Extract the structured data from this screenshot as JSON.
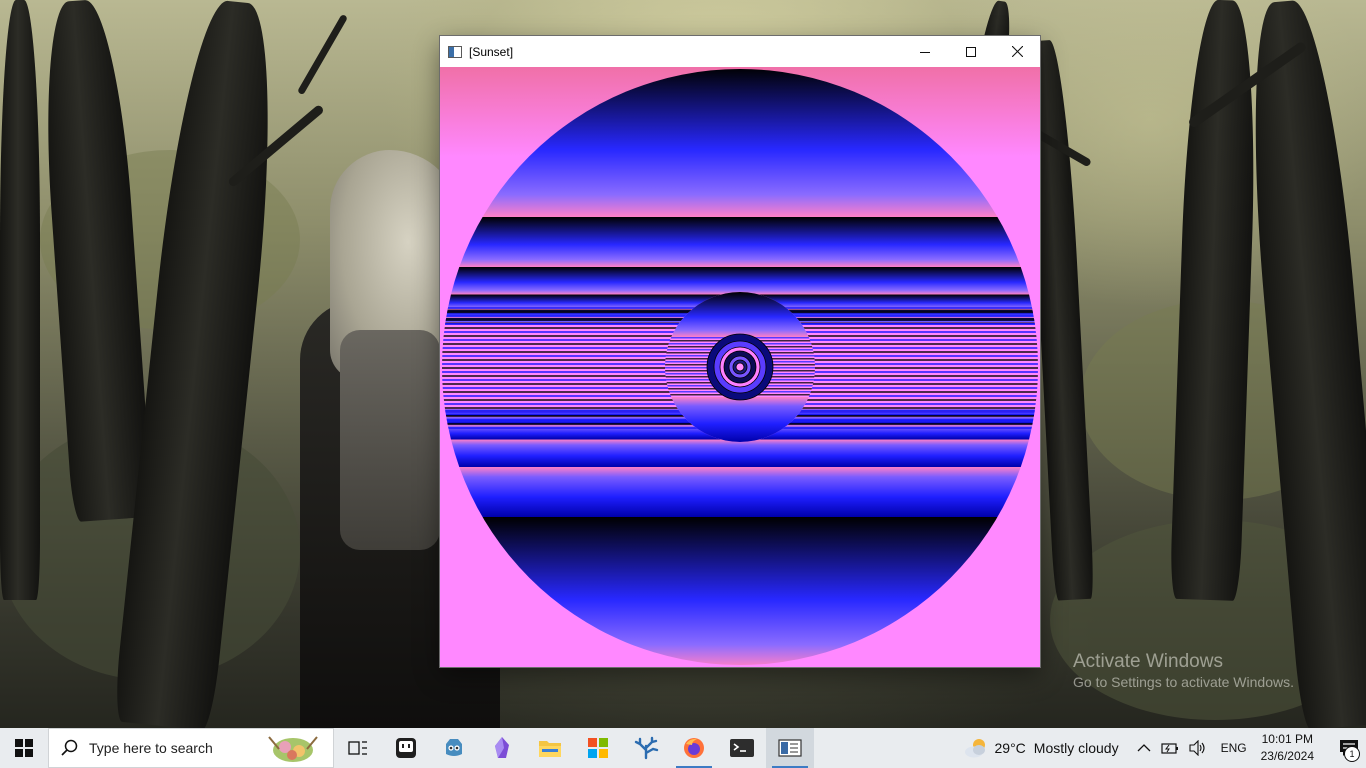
{
  "desktop": {
    "watermark": {
      "title": "Activate Windows",
      "subtitle": "Go to Settings to activate Windows."
    }
  },
  "window": {
    "title": "[Sunset]",
    "controls": [
      "minimize-icon",
      "maximize-icon",
      "close-icon"
    ],
    "render": {
      "sky_top": "#f070a8",
      "sky_mid": "#ff88ff",
      "disc_dark": "#000000",
      "disc_bright": "#1f1fff",
      "band_pink": "#ff80c8"
    }
  },
  "taskbar": {
    "search_placeholder": "Type here to search",
    "pinned": [
      {
        "name": "task-view-icon"
      },
      {
        "name": "terminal-app-icon"
      },
      {
        "name": "godot-icon"
      },
      {
        "name": "obsidian-icon"
      },
      {
        "name": "file-explorer-icon"
      },
      {
        "name": "windows-store-icon"
      },
      {
        "name": "vscode-icon"
      },
      {
        "name": "firefox-icon"
      },
      {
        "name": "windows-terminal-icon"
      },
      {
        "name": "sunset-app-icon"
      }
    ],
    "weather": {
      "temp": "29°C",
      "condition": "Mostly cloudy"
    },
    "language": "ENG",
    "time": "10:01 PM",
    "date": "23/6/2024",
    "notification_count": "1"
  }
}
